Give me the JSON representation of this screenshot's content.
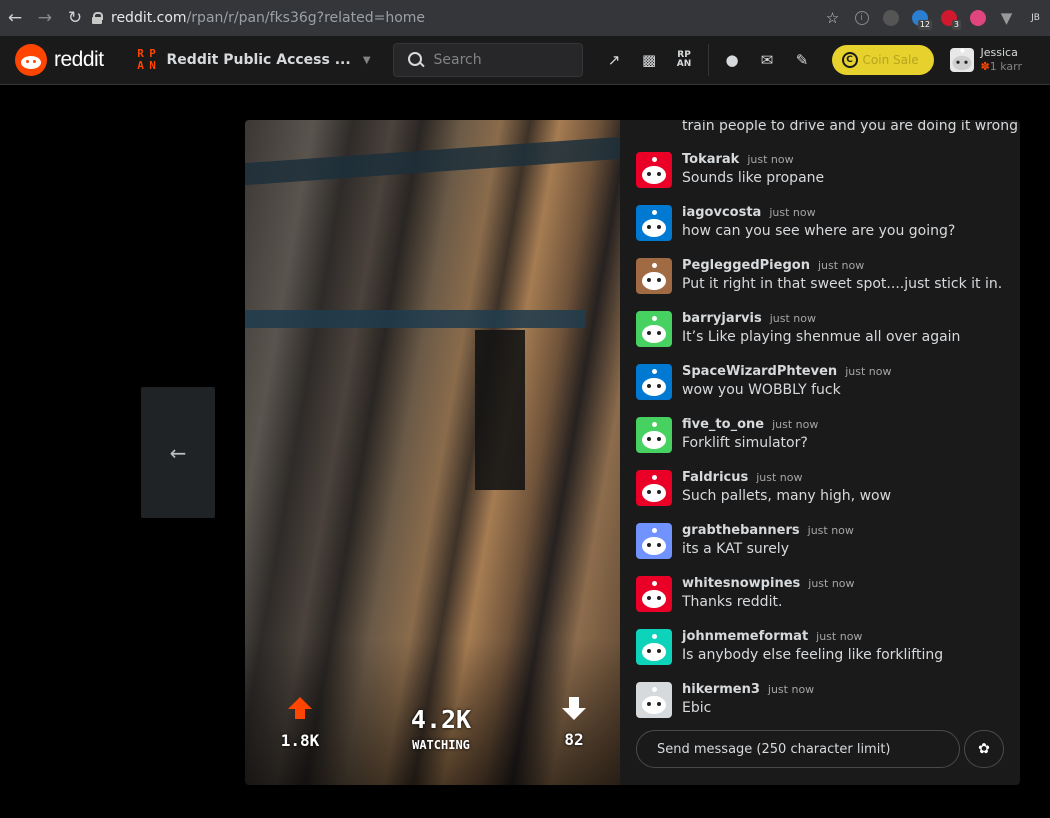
{
  "browser": {
    "url_host": "reddit.com",
    "url_path": "/rpan/r/pan/fks36g?related=home",
    "extensions": [
      {
        "icon": "info-icon",
        "badge": ""
      },
      {
        "icon": "glasses-extension-icon",
        "badge": ""
      },
      {
        "icon": "mask-extension-icon",
        "badge": "12"
      },
      {
        "icon": "adblock-extension-icon",
        "badge": "3"
      },
      {
        "icon": "m-extension-icon",
        "badge": ""
      },
      {
        "icon": "v-extension-icon",
        "badge": ""
      },
      {
        "icon": "jb-extension-icon",
        "badge": ""
      }
    ]
  },
  "header": {
    "wordmark": "reddit",
    "rpan_letters": [
      "R",
      "P",
      "A",
      "N"
    ],
    "community": "Reddit Public Access ...",
    "search_placeholder": "Search",
    "coin_sale_label": "Coin Sale",
    "user_name": "Jessica",
    "user_karma": "1 karr"
  },
  "stream": {
    "upvotes": "1.8K",
    "watching_count": "4.2K",
    "watching_label": "WATCHING",
    "downvotes": "82"
  },
  "chat": {
    "partial_message": "train people to drive and you are doing it wrong",
    "messages": [
      {
        "user": "Tokarak",
        "time": "just now",
        "text": "Sounds like propane",
        "color": "#ea0027"
      },
      {
        "user": "iagovcosta",
        "time": "just now",
        "text": "how can you see where are you going?",
        "color": "#0079d3"
      },
      {
        "user": "PegleggedPiegon",
        "time": "just now",
        "text": "Put it right in that sweet spot....just stick it in.....",
        "color": "#a06a42"
      },
      {
        "user": "barryjarvis",
        "time": "just now",
        "text": "It’s Like playing shenmue all over again",
        "color": "#46d160"
      },
      {
        "user": "SpaceWizardPhteven",
        "time": "just now",
        "text": "wow you WOBBLY fuck",
        "color": "#0079d3"
      },
      {
        "user": "five_to_one",
        "time": "just now",
        "text": "Forklift simulator?",
        "color": "#46d160"
      },
      {
        "user": "Faldricus",
        "time": "just now",
        "text": "Such pallets, many high, wow",
        "color": "#ea0027"
      },
      {
        "user": "grabthebanners",
        "time": "just now",
        "text": "its a KAT surely",
        "color": "#7193ff"
      },
      {
        "user": "whitesnowpines",
        "time": "just now",
        "text": "Thanks reddit.",
        "color": "#ea0027"
      },
      {
        "user": "johnmemeformat",
        "time": "just now",
        "text": "Is anybody else feeling like forklifting",
        "color": "#0dd3bb"
      },
      {
        "user": "hikermen3",
        "time": "just now",
        "text": "Ebic",
        "color": "#d7dadc"
      }
    ],
    "compose_placeholder": "Send message (250 character limit)"
  }
}
